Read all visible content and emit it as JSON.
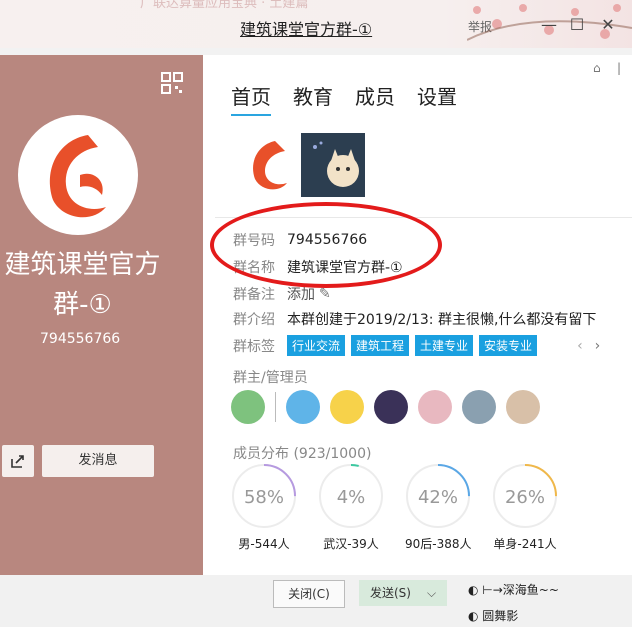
{
  "window": {
    "title": "建筑课堂官方群-①",
    "ghost_title": "广联达算量应用宝典 · 土建篇",
    "report": "举报",
    "minimize": "—",
    "maximize": "☐",
    "close": "✕"
  },
  "left": {
    "group_name": "建筑课堂官方群-①",
    "group_number": "794556766",
    "send_message": "发消息"
  },
  "tabs": [
    "首页",
    "教育",
    "成员",
    "设置"
  ],
  "info": {
    "number_label": "群号码",
    "number": "794556766",
    "name_label": "群名称",
    "name": "建筑课堂官方群-①",
    "remark_label": "群备注",
    "remark": "添加",
    "intro_label": "群介绍",
    "intro": "本群创建于2019/2/13:  群主很懒,什么都没有留下",
    "tags_label": "群标签",
    "tags": [
      "行业交流",
      "建筑工程",
      "土建专业",
      "安装专业"
    ]
  },
  "admins_label": "群主/管理员",
  "distribution": {
    "label": "成员分布",
    "count": "(923/1000)",
    "stats": [
      {
        "percent": "58%",
        "caption": "男-544人",
        "fraction": 0.58,
        "color": "#b69ae0"
      },
      {
        "percent": "4%",
        "caption": "武汉-39人",
        "fraction": 0.04,
        "color": "#3cc8a0"
      },
      {
        "percent": "42%",
        "caption": "90后-388人",
        "fraction": 0.42,
        "color": "#5aa7e6"
      },
      {
        "percent": "26%",
        "caption": "单身-241人",
        "fraction": 0.26,
        "color": "#f0b84a"
      }
    ]
  },
  "footer": {
    "close": "关闭(C)",
    "send": "发送(S)",
    "dropdown": "⌵"
  },
  "members": [
    "⊢→深海鱼~~",
    "圆舞影"
  ]
}
